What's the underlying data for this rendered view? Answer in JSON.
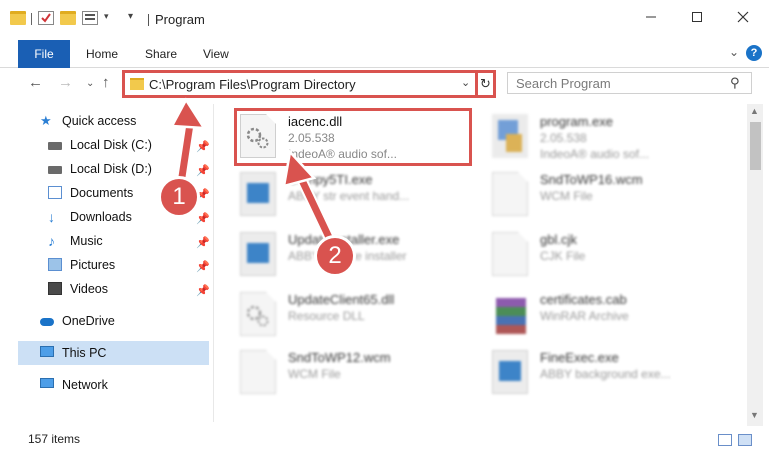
{
  "window": {
    "title": "Program"
  },
  "ribbon": {
    "tabs": [
      "File",
      "Home",
      "Share",
      "View"
    ]
  },
  "address": {
    "path": "C:\\Program Files\\Program Directory",
    "search_placeholder": "Search Program"
  },
  "sidebar": {
    "items": [
      {
        "label": "Quick access",
        "icon": "star-icon"
      },
      {
        "label": "Local Disk (C:)",
        "icon": "drive-icon",
        "pinned": true
      },
      {
        "label": "Local Disk (D:)",
        "icon": "drive-icon",
        "pinned": true
      },
      {
        "label": "Documents",
        "icon": "documents-icon",
        "pinned": true
      },
      {
        "label": "Downloads",
        "icon": "download-icon",
        "pinned": true
      },
      {
        "label": "Music",
        "icon": "music-icon",
        "pinned": true
      },
      {
        "label": "Pictures",
        "icon": "pictures-icon",
        "pinned": true
      },
      {
        "label": "Videos",
        "icon": "videos-icon",
        "pinned": true
      },
      {
        "label": "OneDrive",
        "icon": "cloud-icon"
      },
      {
        "label": "This PC",
        "icon": "computer-icon",
        "selected": true
      },
      {
        "label": "Network",
        "icon": "network-icon"
      }
    ]
  },
  "files": [
    {
      "name": "iacenc.dll",
      "meta": "2.05.538",
      "meta2": "IndeoA® audio sof...",
      "icon": "dll-icon",
      "highlighted": true
    },
    {
      "name": "program.exe",
      "meta": "2.05.538",
      "meta2": "IndeoA® audio sof...",
      "icon": "exe-icon"
    },
    {
      "name": "Compy5TI.exe",
      "meta": "ABBY str event hand...",
      "meta2": "",
      "icon": "app-icon"
    },
    {
      "name": "SndToWP16.wcm",
      "meta": "WCM File",
      "meta2": "",
      "icon": "doc-icon"
    },
    {
      "name": "UpdateInstaller.exe",
      "meta": "ABBY Update installer",
      "meta2": "",
      "icon": "app-icon"
    },
    {
      "name": "gbl.cjk",
      "meta": "CJK File",
      "meta2": "",
      "icon": "doc-icon"
    },
    {
      "name": "UpdateClient65.dll",
      "meta": "Resource DLL",
      "meta2": "",
      "icon": "doc-icon"
    },
    {
      "name": "certificates.cab",
      "meta": "WinRAR Archive",
      "meta2": "",
      "icon": "rar-icon"
    },
    {
      "name": "SndToWP12.wcm",
      "meta": "WCM File",
      "meta2": "",
      "icon": "doc-icon"
    },
    {
      "name": "FineExec.exe",
      "meta": "ABBY background exe...",
      "meta2": "",
      "icon": "app-icon"
    }
  ],
  "annotations": {
    "step1": "1",
    "step2": "2"
  },
  "status": {
    "count": "157 items"
  },
  "colors": {
    "accent": "#1a5fb4",
    "highlight": "#d9534f",
    "selected": "#cce0f5"
  }
}
